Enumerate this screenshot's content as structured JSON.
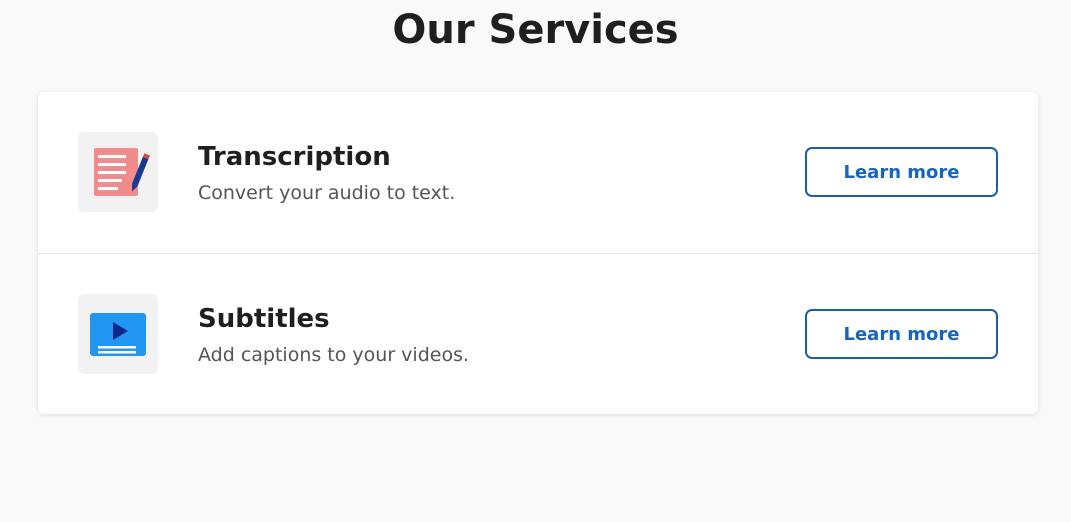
{
  "page": {
    "title": "Our Services"
  },
  "services": [
    {
      "title": "Transcription",
      "description": "Convert your audio to text.",
      "button_label": "Learn more",
      "icon": "document-pen-icon",
      "icon_color": "#f28b8b"
    },
    {
      "title": "Subtitles",
      "description": "Add captions to your videos.",
      "button_label": "Learn more",
      "icon": "video-captions-icon",
      "icon_color": "#2196f3"
    }
  ],
  "colors": {
    "accent": "#1565c0",
    "background": "#f9f9f9",
    "card": "#ffffff",
    "icon_tile": "#f2f2f2"
  }
}
